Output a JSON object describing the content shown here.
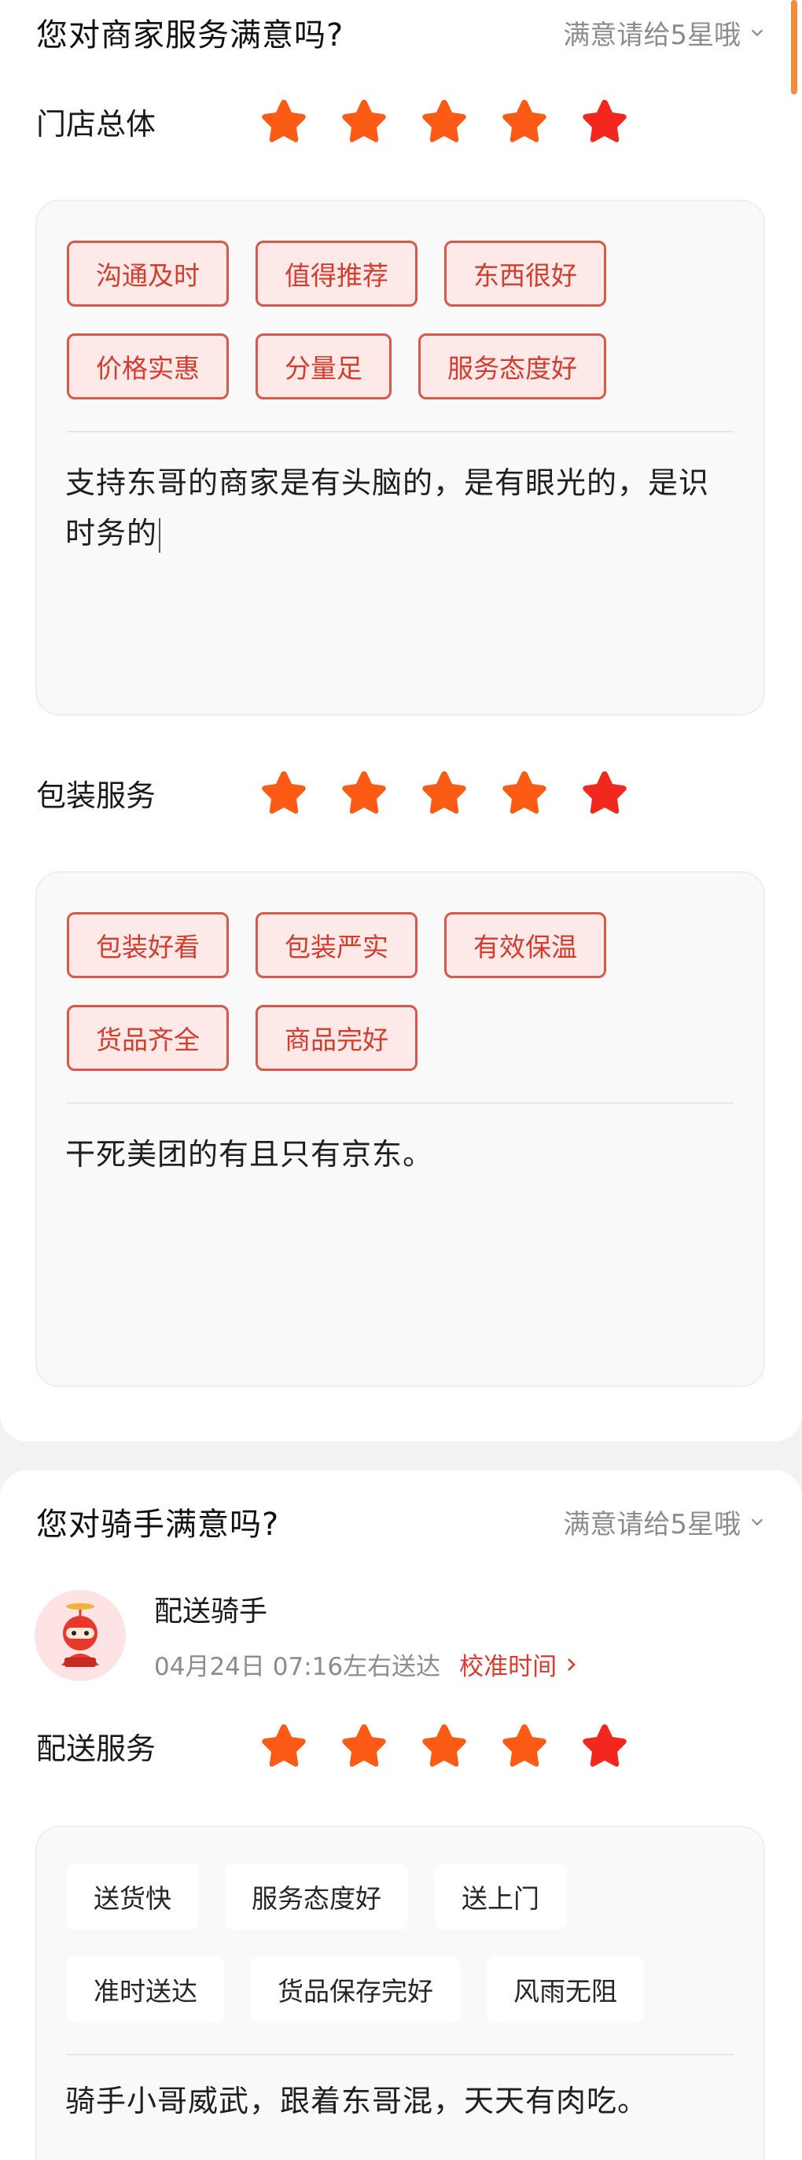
{
  "colors": {
    "star_orange": "#fb5b15",
    "star_red": "#f2281e",
    "tag_red": "#d63c2d",
    "accent": "#e0382a"
  },
  "store": {
    "title": "您对商家服务满意吗?",
    "hint": "满意请给5星哦",
    "overall": {
      "label": "门店总体",
      "stars": 5,
      "tags_row1": [
        "沟通及时",
        "值得推荐",
        "东西很好"
      ],
      "tags_row2": [
        "价格实惠",
        "分量足",
        "服务态度好"
      ],
      "review_line1": "支持东哥的商家是有头脑的，是有眼光的，是识",
      "review_line2": "时务的"
    },
    "packaging": {
      "label": "包装服务",
      "stars": 5,
      "tags_row1": [
        "包装好看",
        "包装严实",
        "有效保温"
      ],
      "tags_row2": [
        "货品齐全",
        "商品完好"
      ],
      "review": "干死美团的有且只有京东。"
    }
  },
  "rider": {
    "title": "您对骑手满意吗?",
    "hint": "满意请给5星哦",
    "name": "配送骑手",
    "delivery_time": "04月24日 07:16左右送达",
    "calibrate": "校准时间",
    "service": {
      "label": "配送服务",
      "stars": 5,
      "tags_row1": [
        "送货快",
        "服务态度好",
        "送上门"
      ],
      "tags_row2": [
        "准时送达",
        "货品保存完好",
        "风雨无阻"
      ],
      "review": "骑手小哥威武，跟着东哥混，天天有肉吃。"
    }
  }
}
